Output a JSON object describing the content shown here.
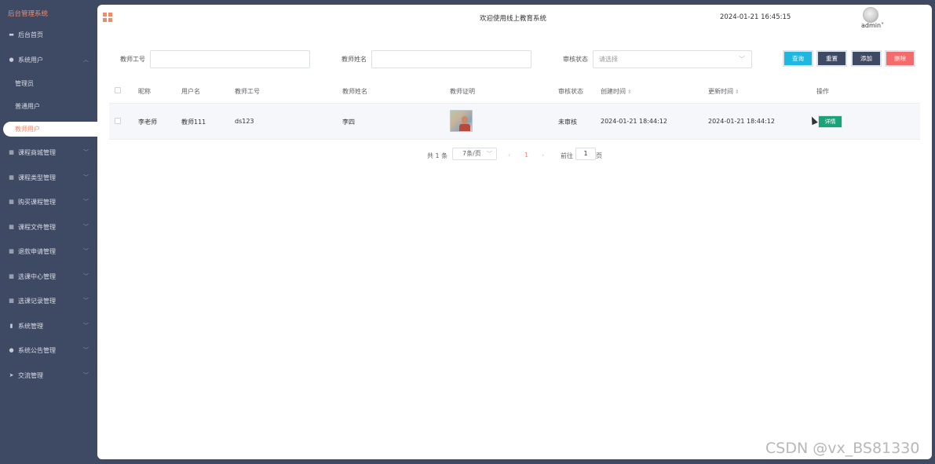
{
  "brand": "后台管理系统",
  "sidebar": {
    "items": [
      {
        "label": "后台首页",
        "icon": "monitor-icon",
        "chevron": false
      },
      {
        "label": "系统用户",
        "icon": "user-icon",
        "chevron": true,
        "expanded": true
      },
      {
        "label": "课程商城管理",
        "icon": "grid-small-icon",
        "chevron": true
      },
      {
        "label": "课程类型管理",
        "icon": "grid-small-icon",
        "chevron": true
      },
      {
        "label": "购买课程管理",
        "icon": "grid-small-icon",
        "chevron": true
      },
      {
        "label": "课程文件管理",
        "icon": "grid-small-icon",
        "chevron": true
      },
      {
        "label": "退款申请管理",
        "icon": "grid-small-icon",
        "chevron": true
      },
      {
        "label": "选课中心管理",
        "icon": "grid-small-icon",
        "chevron": true
      },
      {
        "label": "选课记录管理",
        "icon": "grid-small-icon",
        "chevron": true
      },
      {
        "label": "系统管理",
        "icon": "bar-chart-icon",
        "chevron": true
      },
      {
        "label": "系统公告管理",
        "icon": "info-icon",
        "chevron": true
      },
      {
        "label": "交流管理",
        "icon": "send-icon",
        "chevron": true
      }
    ],
    "sub_items": [
      "管理员",
      "普通用户",
      "教师用户"
    ],
    "active_sub": "教师用户"
  },
  "header": {
    "title": "欢迎使用线上教育系统",
    "time": "2024-01-21 16:45:15",
    "user": "admin"
  },
  "search": {
    "teacher_id_label": "教师工号",
    "teacher_id_value": "",
    "teacher_name_label": "教师姓名",
    "teacher_name_value": "",
    "status_label": "审核状态",
    "status_placeholder": "请选择"
  },
  "buttons": {
    "query": "查询",
    "reset": "重置",
    "add": "添加",
    "delete": "删除"
  },
  "table": {
    "headers": [
      "昵称",
      "用户名",
      "教师工号",
      "教师姓名",
      "教师证明",
      "审核状态",
      "创建时间",
      "更新时间",
      "操作"
    ],
    "rows": [
      {
        "nickname": "李老师",
        "username": "教师111",
        "teacher_id": "ds123",
        "teacher_name": "李四",
        "status": "未审核",
        "created": "2024-01-21 18:44:12",
        "updated": "2024-01-21 18:44:12",
        "action": "详情"
      }
    ]
  },
  "pagination": {
    "total": "共 1 条",
    "page_size": "7条/页",
    "current_page": "1",
    "goto_label": "前往",
    "goto_value": "1",
    "page_unit": "页"
  },
  "colors": {
    "sidebar_bg": "#3e4a63",
    "accent": "#f08a6a",
    "query_btn": "#1fb6e0",
    "reset_btn": "#3e4a63",
    "add_btn": "#3e4a63",
    "delete_btn": "#f46b6b",
    "detail_btn": "#1aa37a"
  },
  "watermark": "CSDN @vx_BS81330"
}
